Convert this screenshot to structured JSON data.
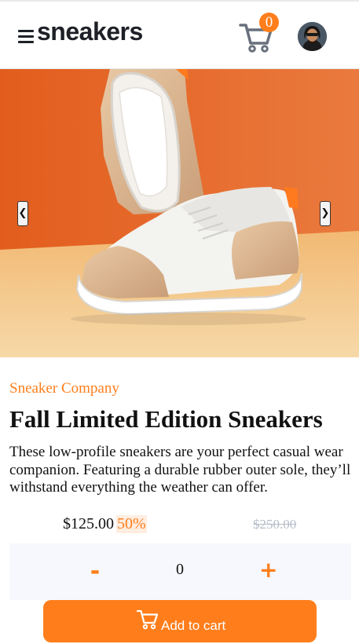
{
  "header": {
    "logo_text": "sneakers",
    "cart_count": "0",
    "icons": [
      "menu-icon",
      "cart-icon",
      "avatar"
    ]
  },
  "gallery": {
    "prev_label": "❮",
    "next_label": "❯",
    "colors": {
      "background_orange": "#e8662a",
      "floor": "#f4c98e"
    }
  },
  "product": {
    "company": "Sneaker Company",
    "title": "Fall Limited Edition Sneakers",
    "description": "These low-profile sneakers are your perfect casual wear companion. Featuring a durable rubber outer sole, they’ll withstand everything the weather can offer.",
    "price": "$125.00",
    "discount": "50%",
    "original_price": "$250.00"
  },
  "quantity": {
    "minus_label": "-",
    "value": "0",
    "plus_label": "+"
  },
  "add_to_cart": {
    "label": "Add to cart"
  },
  "colors": {
    "accent": "#ff7e1b",
    "accent_pale": "#ffede0",
    "dark": "#1d2026",
    "muted": "#b6bcc8",
    "qty_bg": "#f6f8fd"
  }
}
